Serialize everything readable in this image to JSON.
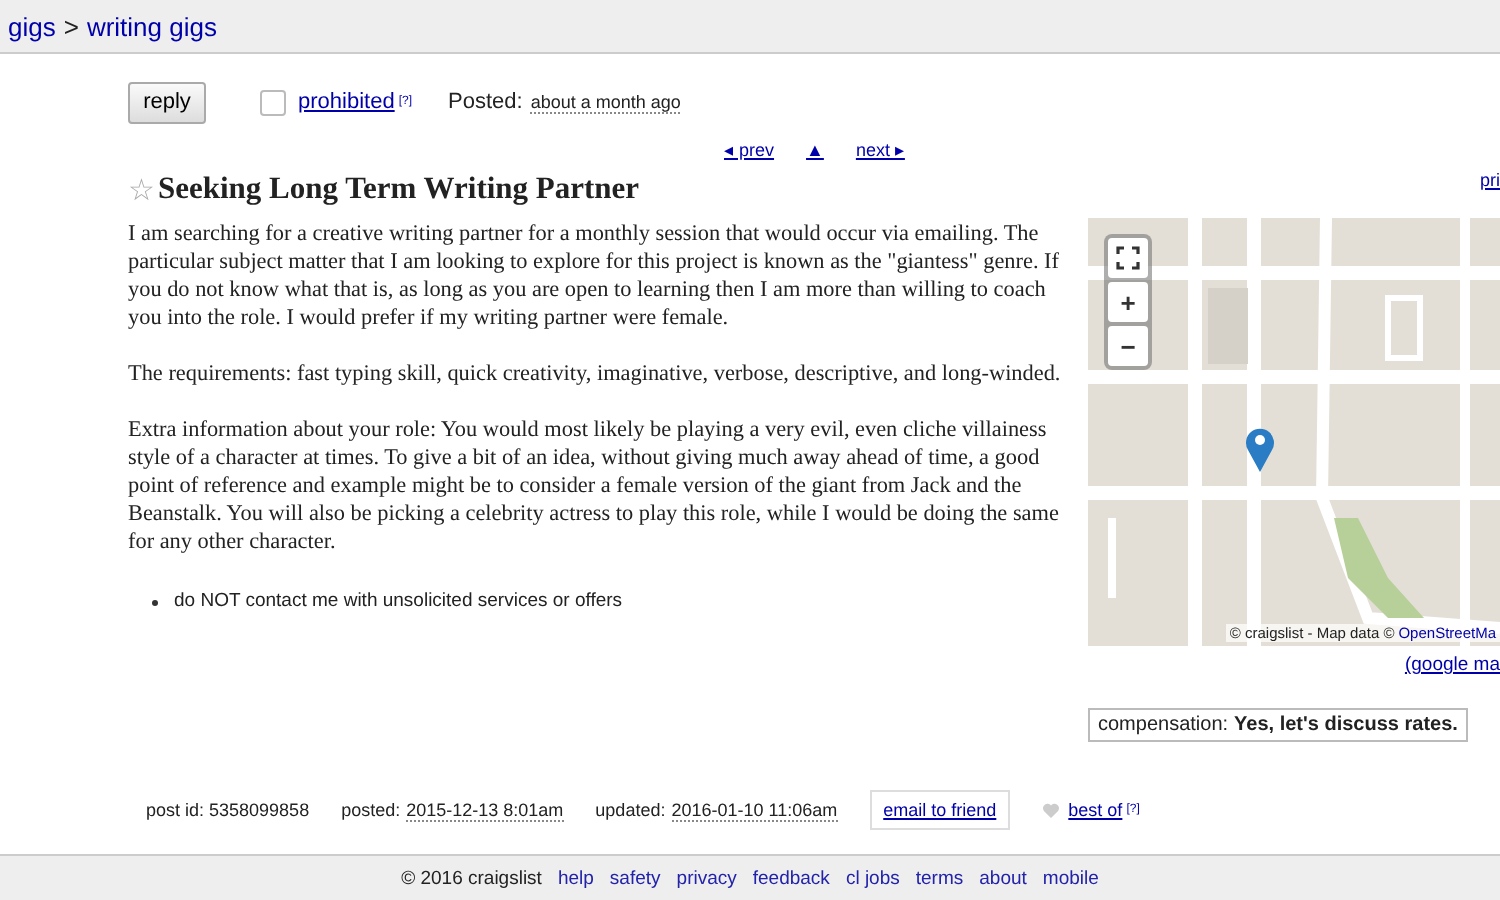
{
  "breadcrumb": {
    "items": [
      "gigs",
      "writing gigs"
    ],
    "separator": ">"
  },
  "actions": {
    "reply": "reply",
    "flag": {
      "label": "prohibited",
      "checked": false,
      "help": "[?]"
    },
    "posted_label": "Posted:",
    "posted_value": "about a month ago"
  },
  "nav": {
    "prev": "◂ prev",
    "up": "▲",
    "next": "next ▸",
    "side_link": "pri"
  },
  "title": {
    "star": "☆",
    "text": "Seeking Long Term Writing Partner"
  },
  "body": {
    "paragraphs": [
      "I am searching for a creative writing partner for a monthly session that would occur via emailing. The particular subject matter that I am looking to explore for this project is known as the \"giantess\" genre. If you do not know what that is, as long as you are open to learning then I am more than willing to coach you into the role. I would prefer if my writing partner were female.",
      "The requirements: fast typing skill, quick creativity, imaginative, verbose, descriptive, and long-winded.",
      "Extra information about your role: You would most likely be playing a very evil, even cliche villainess style of a character at times. To give a bit of an idea, without giving much away ahead of time, a good point of reference and example might be to consider a female version of the giant from Jack and the Beanstalk. You will also be picking a celebrity actress to play this role, while I would be doing the same for any other character."
    ],
    "notices": [
      "do NOT contact me with unsolicited services or offers"
    ]
  },
  "map": {
    "kind": "picture",
    "attribution": "© craigslist - Map data ©",
    "attribution_link": "OpenStreetMa",
    "zoom_in": "+",
    "zoom_out": "−",
    "link": "(google ma"
  },
  "compensation": {
    "label": "compensation:",
    "value": "Yes, let's discuss rates."
  },
  "footer_info": {
    "post_id": "post id: 5358099858",
    "posted_label": "posted:",
    "posted_value": "2015-12-13 8:01am",
    "updated_label": "updated:",
    "updated_value": "2016-01-10 11:06am",
    "email": "email to friend",
    "best_of": "best of",
    "help": "[?]"
  },
  "footer": {
    "copyright": "© 2016 craigslist",
    "links": [
      "help",
      "safety",
      "privacy",
      "feedback",
      "cl jobs",
      "terms",
      "about",
      "mobile"
    ]
  }
}
